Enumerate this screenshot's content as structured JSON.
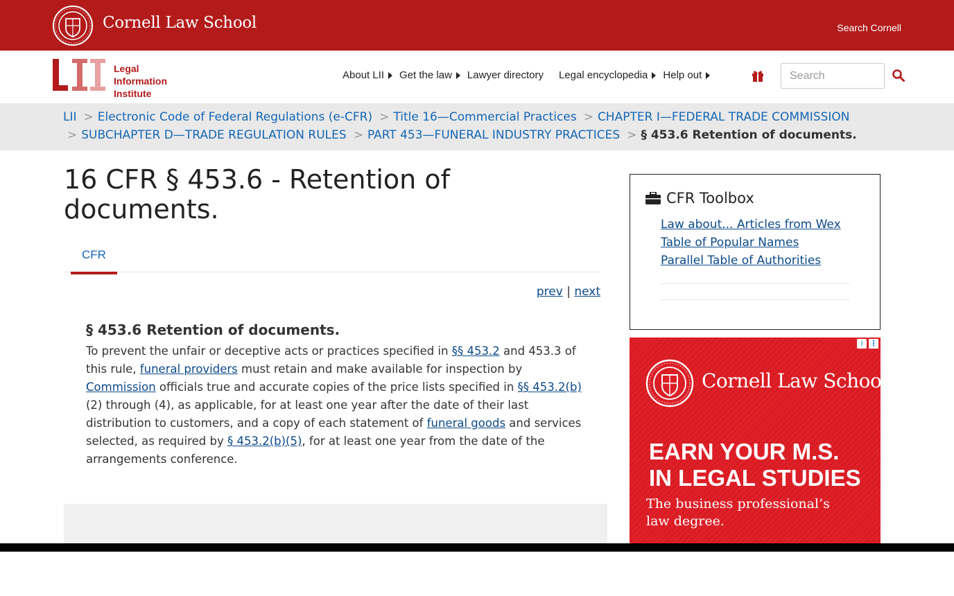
{
  "header": {
    "brand": "Cornell Law School",
    "search_cornell": "Search Cornell"
  },
  "lii": {
    "line1": "Legal",
    "line2": "Information",
    "line3": "Institute"
  },
  "nav": {
    "items": [
      {
        "label": "About LII",
        "caret": true
      },
      {
        "label": "Get the law",
        "caret": true
      },
      {
        "label": "Lawyer directory",
        "caret": false
      },
      {
        "label": "Legal encyclopedia",
        "caret": true
      },
      {
        "label": "Help out",
        "caret": true
      }
    ],
    "search_placeholder": "Search"
  },
  "breadcrumb": {
    "line1": [
      "LII",
      "Electronic Code of Federal Regulations (e-CFR)",
      "Title 16—Commercial Practices",
      "CHAPTER I—FEDERAL TRADE COMMISSION"
    ],
    "line2": [
      "SUBCHAPTER D—TRADE REGULATION RULES",
      "PART 453—FUNERAL INDUSTRY PRACTICES"
    ],
    "current": "§ 453.6 Retention of documents."
  },
  "main": {
    "title": "16 CFR § 453.6 - Retention of documents.",
    "tab": "CFR",
    "prev": "prev",
    "separator": "|",
    "next": "next",
    "section_heading": "§ 453.6 Retention of documents.",
    "body": {
      "t1": "To prevent the unfair or deceptive acts or practices specified in ",
      "l1": "§§ 453.2",
      "t2": " and 453.3 of this rule, ",
      "l2": "funeral providers",
      "t3": " must retain and make available for inspection by ",
      "l3": "Commission",
      "t4": " officials true and accurate copies of the price lists specified in ",
      "l4": "§§ 453.2(b)",
      "t5": " (2) through (4), as applicable, for at least one year after the date of their last distribution to customers, and a copy of each statement of ",
      "l5": "funeral goods",
      "t6": " and services selected, as required by ",
      "l6": "§ 453.2(b)(5)",
      "t7": ", for at least one year from the date of the arrangements conference."
    }
  },
  "toolbox": {
    "title": "CFR Toolbox",
    "links": [
      "Law about... Articles from Wex",
      "Table of Popular Names",
      "Parallel Table of Authorities"
    ]
  },
  "ad": {
    "info": "i",
    "brand": "Cornell Law School",
    "headline_1": "EARN YOUR M.S.",
    "headline_2": "IN LEGAL STUDIES",
    "sub_1": "The business professional’s",
    "sub_2": "law degree."
  },
  "colors": {
    "brand_red": "#b31b1b",
    "link_blue": "#1566b6",
    "ad_red": "#e01f27"
  },
  "icons": [
    "cornell-seal-icon",
    "gift-icon",
    "search-icon",
    "briefcase-icon",
    "ad-info-icon",
    "ad-menu-icon"
  ]
}
